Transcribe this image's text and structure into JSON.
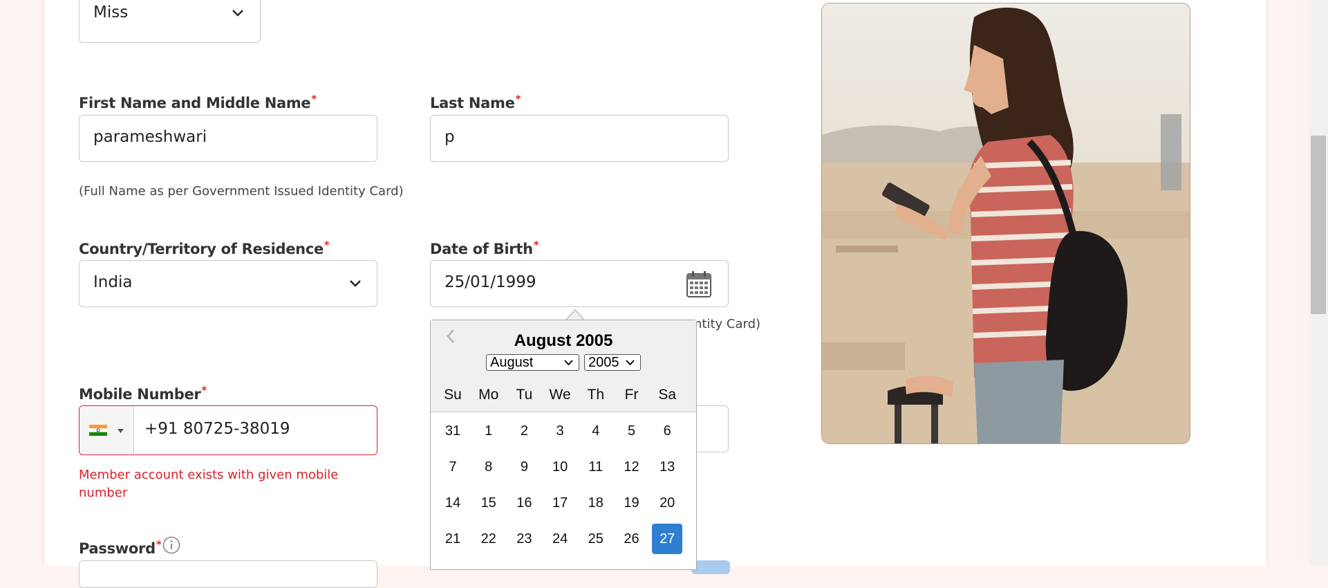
{
  "title_field": {
    "value": "Miss"
  },
  "first_name": {
    "label": "First Name and Middle Name",
    "value": "parameshwari"
  },
  "last_name": {
    "label": "Last Name",
    "value": "p"
  },
  "name_hint": "(Full Name as per Government Issued Identity Card)",
  "country": {
    "label": "Country/Territory of Residence",
    "value": "India"
  },
  "dob": {
    "label": "Date of Birth",
    "value": "25/01/1999",
    "hint_partial": "ntity Card)"
  },
  "mobile": {
    "label": "Mobile Number",
    "value": "+91 80725-38019",
    "error": "Member account exists with given mobile number"
  },
  "password": {
    "label": "Password"
  },
  "required_mark": "*",
  "datepicker": {
    "title": "August 2005",
    "month_select": "August",
    "year_select": "2005",
    "day_names": [
      "Su",
      "Mo",
      "Tu",
      "We",
      "Th",
      "Fr",
      "Sa"
    ],
    "weeks": [
      [
        "31",
        "1",
        "2",
        "3",
        "4",
        "5",
        "6"
      ],
      [
        "7",
        "8",
        "9",
        "10",
        "11",
        "12",
        "13"
      ],
      [
        "14",
        "15",
        "16",
        "17",
        "18",
        "19",
        "20"
      ],
      [
        "21",
        "22",
        "23",
        "24",
        "25",
        "26",
        "27"
      ]
    ],
    "selected_day": "27",
    "prev_icon": "chevron-left-icon"
  },
  "colors": {
    "accent": "#2f7fd1",
    "error": "#d8202a",
    "required": "#d62d2d"
  }
}
